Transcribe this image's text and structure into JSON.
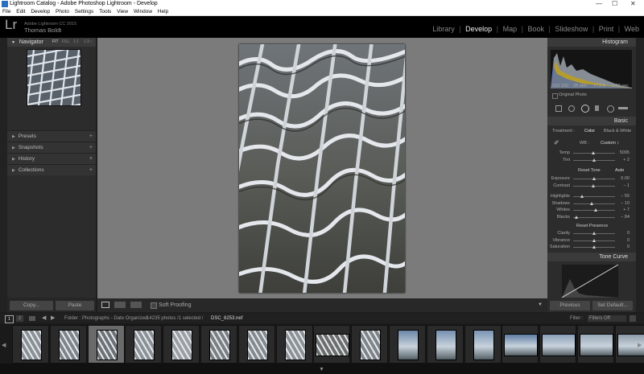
{
  "window": {
    "title": "Lightroom Catalog - Adobe Photoshop Lightroom - Develop",
    "controls": [
      "—",
      "☐",
      "✕"
    ]
  },
  "menu": [
    "File",
    "Edit",
    "Develop",
    "Photo",
    "Settings",
    "Tools",
    "View",
    "Window",
    "Help"
  ],
  "identity": {
    "logo": "Lr",
    "version": "Adobe Lightroom CC 2015",
    "user": "Thomas Boldt"
  },
  "modules": {
    "items": [
      "Library",
      "Develop",
      "Map",
      "Book",
      "Slideshow",
      "Print",
      "Web"
    ],
    "active": "Develop",
    "sep": "|"
  },
  "left": {
    "navigator": {
      "title": "Navigator",
      "zoom": [
        "FIT",
        "FILL",
        "1:1",
        "1:3 ↕"
      ]
    },
    "panels": [
      "Presets",
      "Snapshots",
      "History",
      "Collections"
    ],
    "plus": [
      "+",
      "+",
      "×",
      "+"
    ],
    "copy": "Copy...",
    "paste": "Paste"
  },
  "toolbar": {
    "soft_proofing": "Soft Proofing"
  },
  "right": {
    "histogram": {
      "title": "Histogram",
      "iso": "ISO 100",
      "focal": "28 mm",
      "aperture": "f / 2.8",
      "shutter": "1/60 sec",
      "original": "Original Photo"
    },
    "basic": {
      "title": "Basic",
      "treatment_label": "Treatment :",
      "color": "Color",
      "bw": "Black & White",
      "wb_label": "WB :",
      "wb_value": "Custom ↕",
      "tone_label": "Reset Tone",
      "auto": "Auto",
      "presence_label": "Reset Presence",
      "sliders_wb": [
        {
          "label": "Temp",
          "value": "5095",
          "pos": 0.48
        },
        {
          "label": "Tint",
          "value": "+ 2",
          "pos": 0.5
        }
      ],
      "sliders_tone": [
        {
          "label": "Exposure",
          "value": "0.00",
          "pos": 0.5
        },
        {
          "label": "Contrast",
          "value": "− 1",
          "pos": 0.49
        }
      ],
      "sliders_tone2": [
        {
          "label": "Highlights",
          "value": "− 55",
          "pos": 0.22
        },
        {
          "label": "Shadows",
          "value": "− 10",
          "pos": 0.45
        },
        {
          "label": "Whites",
          "value": "+ 7",
          "pos": 0.54
        },
        {
          "label": "Blacks",
          "value": "− 84",
          "pos": 0.08
        }
      ],
      "sliders_presence": [
        {
          "label": "Clarity",
          "value": "0",
          "pos": 0.5
        },
        {
          "label": "Vibrance",
          "value": "0",
          "pos": 0.5
        },
        {
          "label": "Saturation",
          "value": "0",
          "pos": 0.5
        }
      ]
    },
    "tone_curve": {
      "title": "Tone Curve"
    },
    "previous": "Previous",
    "reset": "Set Default..."
  },
  "filmstrip": {
    "pages": [
      "1",
      "2"
    ],
    "folder": "Folder : Photographs - Date Organized",
    "count": "14235 photos /1 selected /",
    "filename": "DSC_8253.nef",
    "filter_label": "Filter :",
    "filter_value": "Filters Off",
    "selected_index": 2
  }
}
